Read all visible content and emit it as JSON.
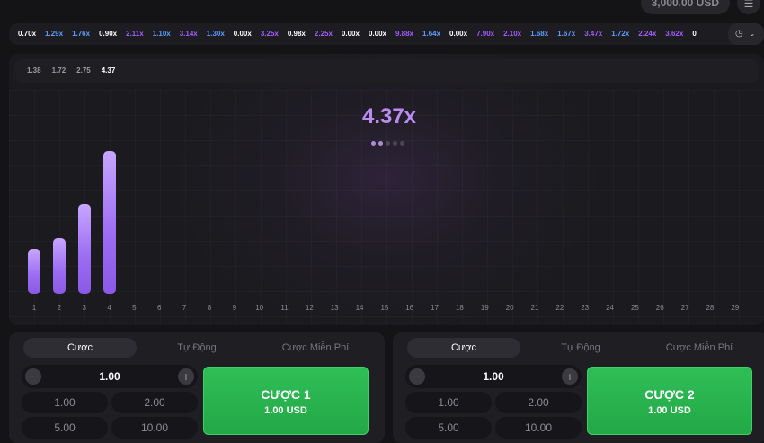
{
  "header": {
    "balance": "3,000.00 USD",
    "menu_icon": "hamburger-icon"
  },
  "history": {
    "multipliers": [
      {
        "v": "0.70x",
        "c": "#ffffff"
      },
      {
        "v": "1.29x",
        "c": "#5c9cff"
      },
      {
        "v": "1.76x",
        "c": "#5c9cff"
      },
      {
        "v": "0.90x",
        "c": "#ffffff"
      },
      {
        "v": "2.11x",
        "c": "#a35cff"
      },
      {
        "v": "1.10x",
        "c": "#5c9cff"
      },
      {
        "v": "3.14x",
        "c": "#a35cff"
      },
      {
        "v": "1.30x",
        "c": "#5c9cff"
      },
      {
        "v": "0.00x",
        "c": "#ffffff"
      },
      {
        "v": "3.25x",
        "c": "#a35cff"
      },
      {
        "v": "0.98x",
        "c": "#ffffff"
      },
      {
        "v": "2.25x",
        "c": "#a35cff"
      },
      {
        "v": "0.00x",
        "c": "#ffffff"
      },
      {
        "v": "0.00x",
        "c": "#ffffff"
      },
      {
        "v": "9.88x",
        "c": "#a35cff"
      },
      {
        "v": "1.64x",
        "c": "#5c9cff"
      },
      {
        "v": "0.00x",
        "c": "#ffffff"
      },
      {
        "v": "7.90x",
        "c": "#a35cff"
      },
      {
        "v": "2.10x",
        "c": "#a35cff"
      },
      {
        "v": "1.68x",
        "c": "#5c9cff"
      },
      {
        "v": "1.67x",
        "c": "#5c9cff"
      },
      {
        "v": "3.47x",
        "c": "#a35cff"
      },
      {
        "v": "1.72x",
        "c": "#5c9cff"
      },
      {
        "v": "2.24x",
        "c": "#a35cff"
      },
      {
        "v": "3.62x",
        "c": "#a35cff"
      },
      {
        "v": "0",
        "c": "#ffffff"
      }
    ],
    "button_icon": "history-clock-icon",
    "chevron_icon": "chevron-down-icon"
  },
  "game": {
    "round_values": [
      "1.38",
      "1.72",
      "2.75",
      "4.37"
    ],
    "current_multiplier": "4.37x",
    "dots_total": 5,
    "dots_active": 2,
    "bar_values": [
      1.38,
      1.72,
      2.75,
      4.37
    ],
    "steps": [
      "1",
      "2",
      "3",
      "4",
      "5",
      "6",
      "7",
      "8",
      "9",
      "10",
      "11",
      "12",
      "13",
      "14",
      "15",
      "16",
      "17",
      "18",
      "19",
      "20",
      "21",
      "22",
      "23",
      "24",
      "25",
      "26",
      "27",
      "28",
      "29"
    ]
  },
  "panels": [
    {
      "tabs": [
        "Cược",
        "Tự Động",
        "Cược Miễn Phí"
      ],
      "active_tab": 0,
      "amount": "1.00",
      "minus": "−",
      "plus": "+",
      "quick": [
        "1.00",
        "2.00",
        "5.00",
        "10.00"
      ],
      "bet_title": "CƯỢC 1",
      "bet_amount": "1.00 USD"
    },
    {
      "tabs": [
        "Cược",
        "Tự Động",
        "Cược Miễn Phí"
      ],
      "active_tab": 0,
      "amount": "1.00",
      "minus": "−",
      "plus": "+",
      "quick": [
        "1.00",
        "2.00",
        "5.00",
        "10.00"
      ],
      "bet_title": "CƯỢC 2",
      "bet_amount": "1.00 USD"
    }
  ]
}
